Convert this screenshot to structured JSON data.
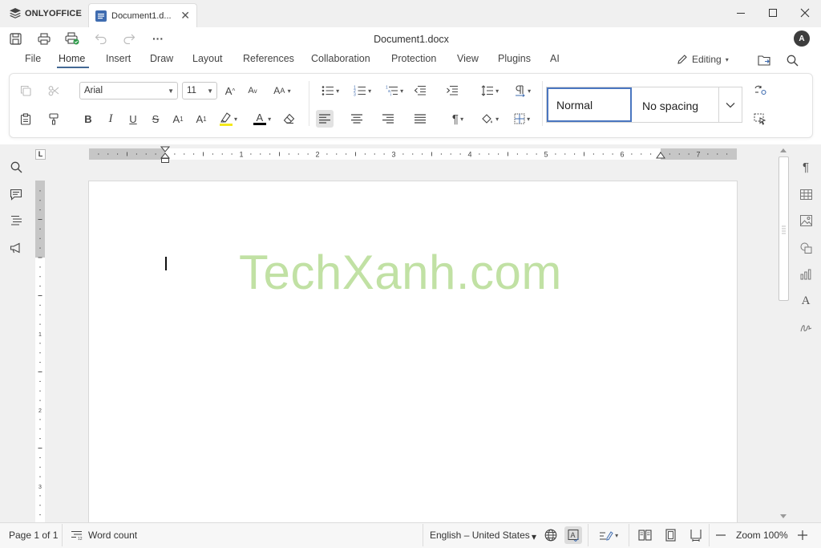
{
  "app": {
    "brand": "ONLYOFFICE",
    "tab_title": "Document1.d...",
    "doc_title": "Document1.docx",
    "avatar_initial": "A"
  },
  "menu": {
    "items": [
      "File",
      "Home",
      "Insert",
      "Draw",
      "Layout",
      "References",
      "Collaboration",
      "Protection",
      "View",
      "Plugins",
      "AI"
    ],
    "active": "Home",
    "mode_label": "Editing"
  },
  "ribbon": {
    "font_name": "Arial",
    "font_size": "11",
    "styles": [
      "Normal",
      "No spacing"
    ],
    "selected_style": "Normal",
    "bold": "B",
    "italic": "I",
    "underline": "U",
    "strike": "S",
    "font_color_letter": "A",
    "highlight_color": "#f4e81b",
    "font_color": "#000000"
  },
  "ruler": {
    "h_numbers": [
      "1",
      "2",
      "3",
      "4",
      "5",
      "6",
      "7"
    ],
    "corner": "L"
  },
  "document": {
    "watermark": "TechXanh.com"
  },
  "statusbar": {
    "page": "Page 1 of 1",
    "word_count": "Word count",
    "language": "English – United States",
    "zoom": "Zoom 100%"
  },
  "colors": {
    "accent": "#446995",
    "style_border": "#4a76c0",
    "watermark": "#b7dc95"
  }
}
